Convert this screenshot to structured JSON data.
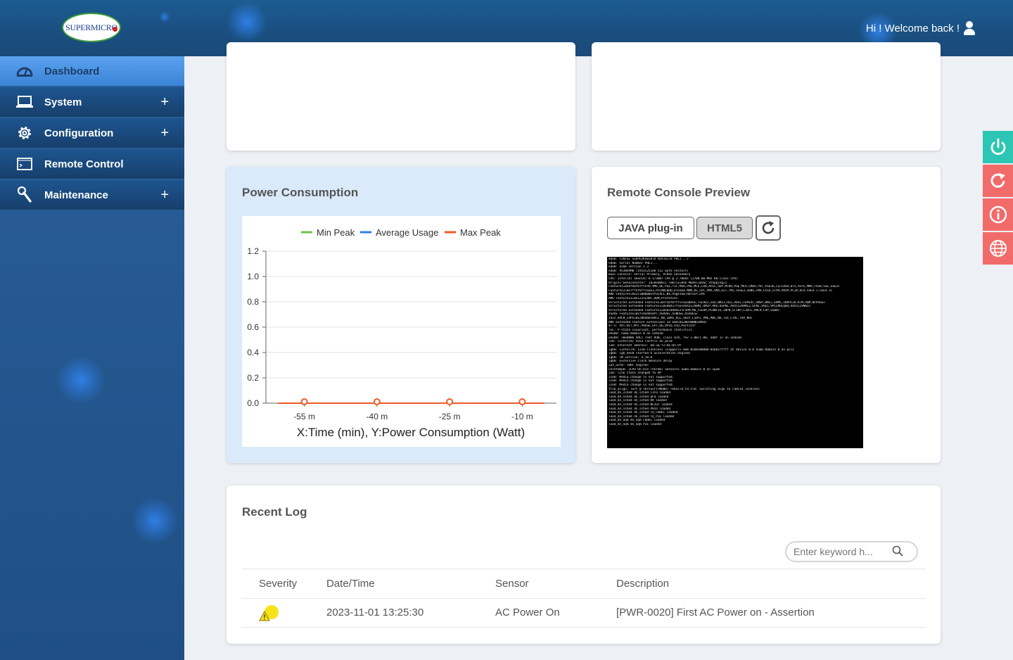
{
  "header": {
    "logo_text": "SUPERMICRO",
    "welcome": "Hi ! Welcome back !"
  },
  "sidebar": {
    "items": [
      {
        "label": "Dashboard",
        "icon": "dashboard-gauge-icon",
        "expandable": false,
        "active": true
      },
      {
        "label": "System",
        "icon": "laptop-icon",
        "expandable": true,
        "active": false
      },
      {
        "label": "Configuration",
        "icon": "gear-icon",
        "expandable": true,
        "active": false
      },
      {
        "label": "Remote Control",
        "icon": "terminal-window-icon",
        "expandable": false,
        "active": false
      },
      {
        "label": "Maintenance",
        "icon": "wrench-icon",
        "expandable": true,
        "active": false
      }
    ],
    "expand_symbol": "+"
  },
  "power": {
    "title": "Power Consumption"
  },
  "chart_data": {
    "type": "line",
    "title": "",
    "xlabel": "X:Time (min), Y:Power Consumption (Watt)",
    "ylabel": "",
    "legend": [
      {
        "name": "Min Peak",
        "color": "#6cc24a"
      },
      {
        "name": "Average Usage",
        "color": "#2f7fe6"
      },
      {
        "name": "Max Peak",
        "color": "#f05a28"
      }
    ],
    "legend_position": "top",
    "categories": [
      "-55 m",
      "-40 m",
      "-25 m",
      "-10 m"
    ],
    "yticks": [
      "0.0",
      "0.2",
      "0.4",
      "0.6",
      "0.8",
      "1.0",
      "1.2"
    ],
    "ylim": [
      0,
      1.2
    ],
    "grid": true,
    "series": [
      {
        "name": "Min Peak",
        "values": [
          0,
          0,
          0,
          0,
          0,
          0,
          0,
          0,
          0,
          0,
          0,
          0
        ]
      },
      {
        "name": "Average Usage",
        "values": [
          0,
          0,
          0,
          0,
          0,
          0,
          0,
          0,
          0,
          0,
          0,
          0
        ]
      },
      {
        "name": "Max Peak",
        "values": [
          0,
          0,
          0,
          0,
          0,
          0,
          0,
          0,
          0,
          0,
          0,
          0
        ]
      }
    ]
  },
  "console": {
    "title": "Remote Console Preview",
    "java_label": "JAVA plug-in",
    "html5_label": "HTML5",
    "selected": "HTML5",
    "screen_lines": [
      "mda0: <INTEL SSDPE2KX010T8 VDV10170 PHLJ...>",
      "nda0: Serial Number PHLJ...",
      "nda0: nvme version 1.3",
      "nda0: 953869MB (1953525168 512 byte sectors)",
      "Dual Console: Serial Primary, Video Secondary",
      "CPU: Intel(R) Xeon(R) D-1736NT CPU @ 2.70GHz (2700.00-MHz K8-class CPU)",
      "  Origin=\"GenuineIntel\"  Id=0x606c1  Family=0x6  Model=0x6c  Stepping=1",
      "  Features=0xbfebfbff<FPU,VME,DE,PSE,TSC,MSR,PAE,MCE,CX8,APIC,SEP,MTRR,PGE,MCA,CMOV,PAT,PSE36,CLFLUSH,DTS,ACPI,MMX,FXSR,SSE,SSE2>",
      "  Features2=0x7ffefbff<SSE3,PCLMULQDQ,DTES64,MON,DS_CPL,VMX,SMX,EST,TM2,SSSE3,SDBG,FMA,CX16,xTPR,PDCM,PCID,DCA,SSE4.1,SSE4.2>",
      "  AMD Features=0x2c100800<SYSCALL,NX,Page1GB,RDTSCP,LM>",
      "  AMD Features2=0x121<LAHF,ABM,Prefetch>",
      "  Structured Extended Features=0xf3bfbfff<FSGSBASE,TSCADJ,SGX,BMI1,HLE,AVX2,FDPEXC,SMEP,BMI2,ERMS,INVPCID,RTM,PQM,NFPUSG>",
      "  Structured Extended Features2=0x40417f5e<AVX512VBMI,UMIP,PKU,OSPKE,AVX512VBMI2,GFNI,VAES,VPCLMULQDQ,AVX512VNNI>",
      "  Structured Extended Features3=0xbc040412<FSRM,MD_CLEAR,PCONFIG,IBPB,STIBP,L1DFL,ARCH_CAP,SSBD>",
      "  XSAVE Features=0xf<XSAVEOPT,XSAVEC,XINUSE,XSAVES>",
      "  IA32_ARCH_CAPS=0x20bd6b<RDCL_NO,IBRS_ALL,SKIP_L1DFL_VME,MDS_NO,TSX_CTRL,TAA_NO>",
      "  AMD Extended Feature Extensions ID EBX=0x200<WBNOINVD>",
      "  VT-x: PAT,HLT,MTF,PAUSE,EPT,UG,VPID,VID,PostIntr",
      "  TSC: P-state invariant, performance statistics",
      "uhub0: numa-domain 0 on usbus0",
      "uhub0: <0x8086 XHCI root HUB, class 9/0, rev 3.00/1.00, addr 1> on usbus0",
      "ix0: <Intel(R) X553 (SFP+)> on pci0",
      "ix0: Ethernet address: b8:3a:f2:b6:05:9f",
      "igb0: <Intel(R) I210 Flashless (Copper)> mem 0xb8200000-0xb827ffff at device 0.0 numa-domain 0 on pci1",
      "igb0: igb_dev0 started 6 acceleration engines",
      "igb0: FW version: 4.10.0",
      "igb0: Excessive clock measure delay",
      "ipt_ucf0: <UHT engine>",
      "coretemp0: <CPU On-Die Thermal Sensors> numa-domain 0 on cpu0",
      "ix0: link state changed to UP",
      "ice0: Media change is not supported.",
      "ice0: Media change is not supported.",
      "ice0: Media change is not supported.",
      "ttlb_align: lwrt_0 <br>usr(rNOBD) rebuild_td_tlm: switching algo to radix4_lockless",
      "load_dn_sched dn_sched FIFO loaded",
      "load_dn_sched dn_sched QFQ loaded",
      "load_dn_sched dn_sched RR loaded",
      "load_dn_sched dn_sched WF2Q+ loaded",
      "load_dn_sched dn_sched PRIO loaded",
      "load_dn_sched dn_sched FQ_CODEL loaded",
      "load_dn_sched dn_sched FQ_PIE loaded",
      "load_dn_aqm dn_aqm CODEL loaded",
      "load_dn_aqm dn_aqm PIE loaded"
    ]
  },
  "side_tools": [
    {
      "name": "power-button",
      "icon": "power-icon",
      "color": "#2dc6b4"
    },
    {
      "name": "reset-button",
      "icon": "refresh-icon",
      "color": "#f26b6b"
    },
    {
      "name": "info-button",
      "icon": "info-icon",
      "color": "#f26b6b"
    },
    {
      "name": "language-button",
      "icon": "globe-icon",
      "color": "#f26b6b"
    }
  ],
  "log": {
    "title": "Recent Log",
    "search_placeholder": "Enter keyword h...",
    "columns": [
      "Severity",
      "Date/Time",
      "Sensor",
      "Description"
    ],
    "rows": [
      {
        "severity_icon": "warning-icon",
        "datetime": "2023-11-01 13:25:30",
        "sensor": "AC Power On",
        "description": "[PWR-0020] First AC Power on - Assertion"
      }
    ]
  }
}
